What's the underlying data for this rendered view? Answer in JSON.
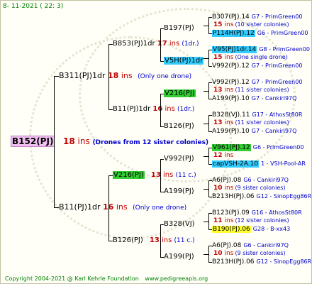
{
  "header": {
    "date": "8- 11-2021 ( 22: 3)"
  },
  "root": {
    "name": "B152(PJ)",
    "count": "18",
    "ins": "ins",
    "note": "(Drones from 12 sister colonies)",
    "bg": "#f0c0f0"
  },
  "gen1": [
    {
      "name": "B311(PJ)1dr",
      "count": "18",
      "ins": "ins",
      "note": "(Only one drone)"
    },
    {
      "name": "B11(PJ)1dr",
      "count": "16",
      "ins": "ins",
      "note": "(Only one drone)"
    }
  ],
  "gen2": [
    {
      "name": "B853(PJ)1dr",
      "count": "17",
      "ins": "ins",
      "note": "(1dr.)"
    },
    {
      "name": "B11(PJ)1dr",
      "count": "16",
      "ins": "ins",
      "note": "(1dr.)"
    },
    {
      "name": "V216(PJ)",
      "count": "13",
      "ins": "ins",
      "note": "(11 c.)",
      "bg": "#33cc33"
    },
    {
      "name": "B126(PJ)",
      "count": "13",
      "ins": "ins",
      "note": "(11 c.)"
    }
  ],
  "gen3": [
    {
      "name": "B197(PJ)"
    },
    {
      "name": "V5H(PJ)1dr",
      "bg": "#33ccff"
    },
    {
      "name": "V216(PJ)",
      "bg": "#33cc33"
    },
    {
      "name": "B126(PJ)"
    },
    {
      "name": "V992(PJ)"
    },
    {
      "name": "A199(PJ)"
    },
    {
      "name": "B328(VJ)"
    },
    {
      "name": "A199(PJ)"
    }
  ],
  "gen4": [
    {
      "name": "B307(PJ).14",
      "breeder": "G7 - PrimGreen00",
      "count": "15",
      "ins": "ins",
      "note": "(10 sister colonies)"
    },
    {
      "name": "P114H(PJ).12",
      "breeder": "G6 - PrimGreen00",
      "bg": "#33ccff"
    },
    {
      "name": "V95(PJ)1dr.14",
      "breeder": "G8 - PrimGreen00",
      "bg": "#33ccff",
      "count": "15",
      "ins": "ins",
      "note": "(One single drone)"
    },
    {
      "name": "V992(PJ).12",
      "breeder": "G7 - PrimGreen00"
    },
    {
      "name": "V992(PJ).12",
      "breeder": "G7 - PrimGreen00",
      "count": "13",
      "ins": "ins",
      "note": "(11 sister colonies)"
    },
    {
      "name": "A199(PJ).10",
      "breeder": "G7 - Cankiri97Q"
    },
    {
      "name": "B328(VJ).11",
      "breeder": "G17 - AthosSt80R",
      "count": "13",
      "ins": "ins",
      "note": "(11 sister colonies)"
    },
    {
      "name": "A199(PJ).10",
      "breeder": "G7 - Cankiri97Q"
    },
    {
      "name": "V961(PJ).12",
      "breeder": "G6 - PrimGreen00",
      "bg": "#33cc33",
      "count": "12",
      "ins": "ins",
      "note": ""
    },
    {
      "name": "capVSH-2A.10",
      "breeder": "1 - VSH-Pool-AR",
      "bg": "#33ccff"
    },
    {
      "name": "A6(PJ).08",
      "breeder": "G6 - Cankiri97Q",
      "count": "10",
      "ins": "ins",
      "note": "(9 sister colonies)"
    },
    {
      "name": "B213H(PJ).06",
      "breeder": "G12 - SinopEgg86R"
    },
    {
      "name": "B123(PJ).09",
      "breeder": "G16 - AthosSt80R",
      "count": "11",
      "ins": "ins",
      "note": "(12 sister colonies)"
    },
    {
      "name": "B190(PJ).06",
      "breeder": "G28 - B-xx43",
      "bg": "#ffff33"
    },
    {
      "name": "A6(PJ).08",
      "breeder": "G6 - Cankiri97Q",
      "count": "10",
      "ins": "ins",
      "note": "(9 sister colonies)"
    },
    {
      "name": "B213H(PJ).06",
      "breeder": "G12 - SinopEgg86R"
    }
  ],
  "footer": {
    "copyright": "Copyright 2004-2021 @ Karl Kehrle Foundation",
    "url": "www.pedigreeapis.org"
  }
}
